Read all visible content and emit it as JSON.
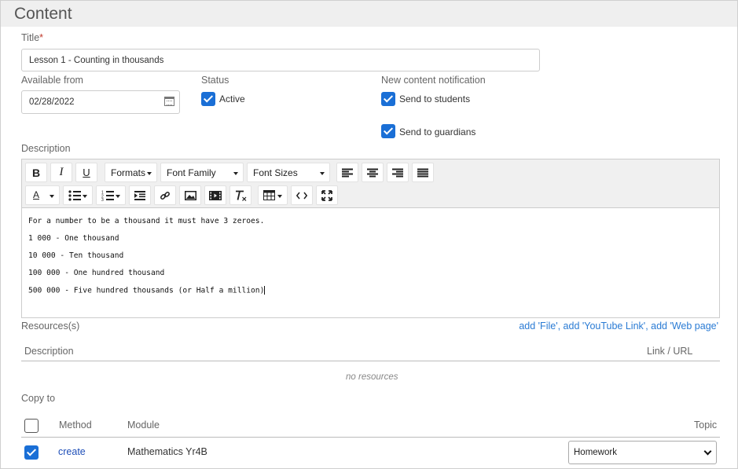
{
  "header": {
    "title": "Content"
  },
  "title_field": {
    "label": "Title",
    "required_mark": "*",
    "value": "Lesson 1 - Counting in thousands"
  },
  "available_from": {
    "label": "Available from",
    "value": "02/28/2022",
    "icon": "calendar-icon"
  },
  "status": {
    "label": "Status",
    "active_label": "Active",
    "active_checked": true
  },
  "notification": {
    "label": "New content notification",
    "students_label": "Send to students",
    "students_checked": true,
    "guardians_label": "Send to guardians",
    "guardians_checked": true
  },
  "description": {
    "label": "Description",
    "toolbar": {
      "bold": "B",
      "italic": "I",
      "underline": "U",
      "formats": "Formats",
      "font_family": "Font Family",
      "font_sizes": "Font Sizes",
      "text_color": "A"
    },
    "content_lines": [
      "For a number to be a thousand it must have 3 zeroes.",
      "1 000 - One thousand",
      "10 000 - Ten thousand",
      "100 000 - One hundred thousand",
      "500 000 - Five hundred thousands (or Half a million)"
    ]
  },
  "resources": {
    "label": "Resources(s)",
    "add_file": "add 'File'",
    "add_youtube": "add 'YouTube Link'",
    "add_web": "add 'Web page'",
    "columns": {
      "description": "Description",
      "link": "Link / URL"
    },
    "empty_text": "no resources"
  },
  "copy_to": {
    "label": "Copy to",
    "columns": {
      "method": "Method",
      "module": "Module",
      "topic": "Topic"
    },
    "select_all_checked": false,
    "rows": [
      {
        "checked": true,
        "method": "create",
        "module": "Mathematics Yr4B",
        "topic": "Homework"
      }
    ]
  },
  "colors": {
    "accent": "#1a6fd6",
    "link": "#2a7bd4",
    "header_bg": "#efefef"
  }
}
